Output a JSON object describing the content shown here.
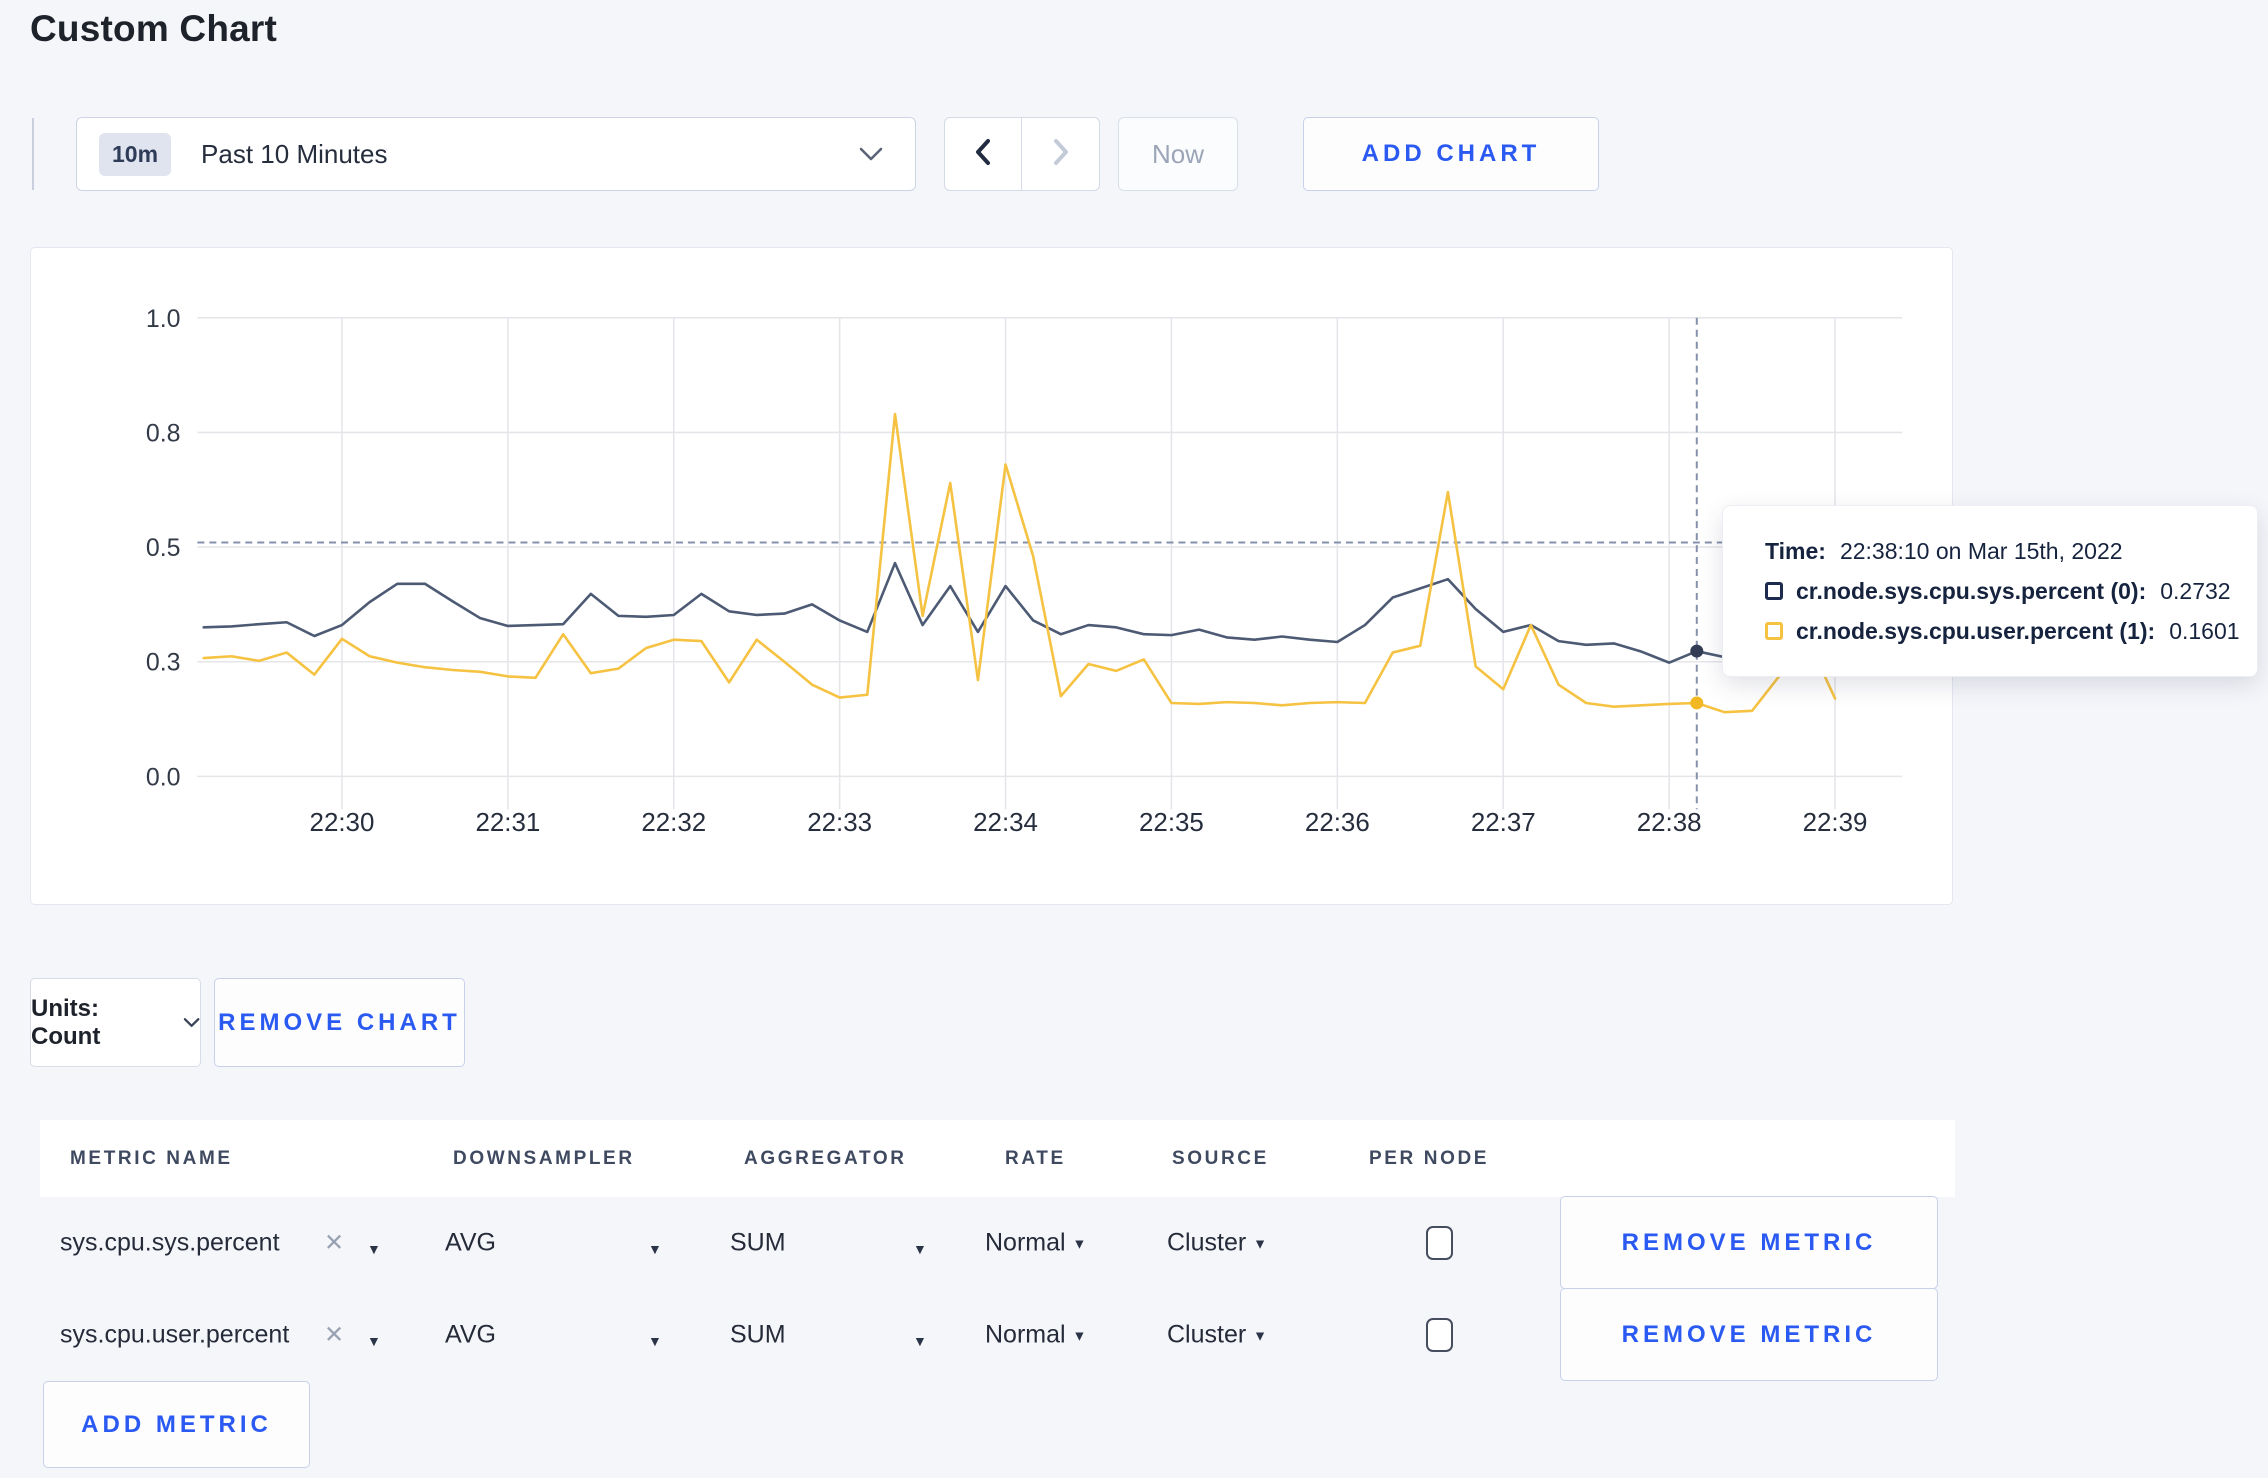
{
  "header": {
    "title": "Custom Chart"
  },
  "toolbar": {
    "timeframe": {
      "badge": "10m",
      "label": "Past 10 Minutes"
    },
    "now_label": "Now",
    "add_chart_label": "ADD CHART"
  },
  "accent_colors": {
    "action_blue": "#2a5af2",
    "series_slate": "#4d5a73",
    "series_yellow": "#f5c242"
  },
  "chart_data": {
    "type": "line",
    "title": "",
    "xlabel": "",
    "ylabel": "",
    "x_ticks": [
      "22:30",
      "22:31",
      "22:32",
      "22:33",
      "22:34",
      "22:35",
      "22:36",
      "22:37",
      "22:38",
      "22:39"
    ],
    "y_ticks": [
      {
        "value": 0,
        "label": "0.0"
      },
      {
        "value": 0.25,
        "label": "0.3"
      },
      {
        "value": 0.5,
        "label": "0.5"
      },
      {
        "value": 0.75,
        "label": "0.8"
      },
      {
        "value": 1,
        "label": "1.0"
      }
    ],
    "ylim": [
      0,
      1
    ],
    "grid": true,
    "legend_position": "tooltip",
    "x_axis_note": "time offsets in seconds relative to 22:30:00, window spans ~22:29:10 to 22:39:00",
    "series": [
      {
        "name": "cr.node.sys.cpu.sys.percent (0)",
        "color": "#4d5a73",
        "dot_color": "#323c55",
        "points": [
          [
            -50,
            0.325
          ],
          [
            -40,
            0.327
          ],
          [
            -30,
            0.332
          ],
          [
            -20,
            0.336
          ],
          [
            -10,
            0.306
          ],
          [
            0,
            0.33
          ],
          [
            10,
            0.38
          ],
          [
            20,
            0.42
          ],
          [
            30,
            0.42
          ],
          [
            40,
            0.382
          ],
          [
            50,
            0.345
          ],
          [
            60,
            0.328
          ],
          [
            70,
            0.33
          ],
          [
            80,
            0.332
          ],
          [
            90,
            0.398
          ],
          [
            100,
            0.35
          ],
          [
            110,
            0.348
          ],
          [
            120,
            0.352
          ],
          [
            130,
            0.398
          ],
          [
            140,
            0.36
          ],
          [
            150,
            0.352
          ],
          [
            160,
            0.355
          ],
          [
            170,
            0.375
          ],
          [
            180,
            0.34
          ],
          [
            190,
            0.315
          ],
          [
            200,
            0.465
          ],
          [
            210,
            0.33
          ],
          [
            220,
            0.415
          ],
          [
            230,
            0.315
          ],
          [
            240,
            0.415
          ],
          [
            250,
            0.34
          ],
          [
            260,
            0.31
          ],
          [
            270,
            0.33
          ],
          [
            280,
            0.325
          ],
          [
            290,
            0.31
          ],
          [
            300,
            0.308
          ],
          [
            310,
            0.32
          ],
          [
            320,
            0.303
          ],
          [
            330,
            0.298
          ],
          [
            340,
            0.305
          ],
          [
            350,
            0.298
          ],
          [
            360,
            0.293
          ],
          [
            370,
            0.33
          ],
          [
            380,
            0.39
          ],
          [
            390,
            0.41
          ],
          [
            400,
            0.43
          ],
          [
            410,
            0.365
          ],
          [
            420,
            0.315
          ],
          [
            430,
            0.33
          ],
          [
            440,
            0.295
          ],
          [
            450,
            0.287
          ],
          [
            460,
            0.29
          ],
          [
            470,
            0.272
          ],
          [
            480,
            0.248
          ],
          [
            490,
            0.273
          ],
          [
            500,
            0.26
          ],
          [
            510,
            0.285
          ],
          [
            520,
            0.3
          ],
          [
            530,
            0.298
          ],
          [
            540,
            0.3
          ]
        ]
      },
      {
        "name": "cr.node.sys.cpu.user.percent (1)",
        "color": "#f5c242",
        "dot_color": "#f2b824",
        "points": [
          [
            -50,
            0.258
          ],
          [
            -40,
            0.262
          ],
          [
            -30,
            0.252
          ],
          [
            -20,
            0.27
          ],
          [
            -10,
            0.222
          ],
          [
            0,
            0.3
          ],
          [
            10,
            0.262
          ],
          [
            20,
            0.248
          ],
          [
            30,
            0.238
          ],
          [
            40,
            0.232
          ],
          [
            50,
            0.228
          ],
          [
            60,
            0.218
          ],
          [
            70,
            0.215
          ],
          [
            80,
            0.31
          ],
          [
            90,
            0.225
          ],
          [
            100,
            0.235
          ],
          [
            110,
            0.28
          ],
          [
            120,
            0.298
          ],
          [
            130,
            0.295
          ],
          [
            140,
            0.205
          ],
          [
            150,
            0.298
          ],
          [
            160,
            0.25
          ],
          [
            170,
            0.2
          ],
          [
            180,
            0.172
          ],
          [
            190,
            0.178
          ],
          [
            200,
            0.79
          ],
          [
            210,
            0.35
          ],
          [
            220,
            0.64
          ],
          [
            230,
            0.21
          ],
          [
            240,
            0.68
          ],
          [
            250,
            0.48
          ],
          [
            260,
            0.175
          ],
          [
            270,
            0.245
          ],
          [
            280,
            0.23
          ],
          [
            290,
            0.255
          ],
          [
            300,
            0.16
          ],
          [
            310,
            0.158
          ],
          [
            320,
            0.162
          ],
          [
            330,
            0.16
          ],
          [
            340,
            0.155
          ],
          [
            350,
            0.16
          ],
          [
            360,
            0.162
          ],
          [
            370,
            0.16
          ],
          [
            380,
            0.27
          ],
          [
            390,
            0.285
          ],
          [
            400,
            0.62
          ],
          [
            410,
            0.24
          ],
          [
            420,
            0.19
          ],
          [
            430,
            0.33
          ],
          [
            440,
            0.2
          ],
          [
            450,
            0.16
          ],
          [
            460,
            0.152
          ],
          [
            470,
            0.155
          ],
          [
            480,
            0.158
          ],
          [
            490,
            0.16
          ],
          [
            500,
            0.14
          ],
          [
            510,
            0.143
          ],
          [
            520,
            0.22
          ],
          [
            530,
            0.3
          ],
          [
            540,
            0.17
          ]
        ]
      }
    ],
    "crosshair": {
      "time_offset_seconds": 490,
      "hover_value": 0.51,
      "values": [
        0.2732,
        0.1601
      ]
    },
    "tooltip": {
      "time_label": "Time:",
      "time_value": "22:38:10 on Mar 15th, 2022",
      "rows": [
        {
          "name": "cr.node.sys.cpu.sys.percent (0):",
          "value": "0.2732",
          "swatch": "#1d2b4e"
        },
        {
          "name": "cr.node.sys.cpu.user.percent (1):",
          "value": "0.1601",
          "swatch": "#f5c242"
        }
      ]
    }
  },
  "units": {
    "label": "Units: Count"
  },
  "remove_chart_label": "REMOVE CHART",
  "table": {
    "headers": [
      "METRIC NAME",
      "DOWNSAMPLER",
      "AGGREGATOR",
      "RATE",
      "SOURCE",
      "PER NODE"
    ],
    "rows": [
      {
        "metric": "sys.cpu.sys.percent",
        "downsampler": "AVG",
        "aggregator": "SUM",
        "rate": "Normal",
        "source": "Cluster",
        "per_node": false,
        "remove_label": "REMOVE METRIC"
      },
      {
        "metric": "sys.cpu.user.percent",
        "downsampler": "AVG",
        "aggregator": "SUM",
        "rate": "Normal",
        "source": "Cluster",
        "per_node": false,
        "remove_label": "REMOVE METRIC"
      }
    ],
    "add_metric_label": "ADD METRIC"
  }
}
